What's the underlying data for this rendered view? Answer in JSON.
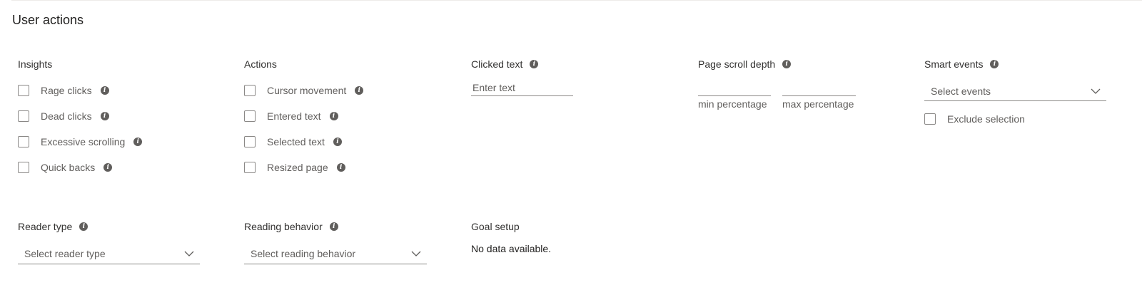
{
  "section": {
    "title": "User actions"
  },
  "insights": {
    "title": "Insights",
    "items": [
      {
        "label": "Rage clicks",
        "checked": false
      },
      {
        "label": "Dead clicks",
        "checked": false
      },
      {
        "label": "Excessive scrolling",
        "checked": false
      },
      {
        "label": "Quick backs",
        "checked": false
      }
    ]
  },
  "actions": {
    "title": "Actions",
    "items": [
      {
        "label": "Cursor movement",
        "checked": false
      },
      {
        "label": "Entered text",
        "checked": false
      },
      {
        "label": "Selected text",
        "checked": false
      },
      {
        "label": "Resized page",
        "checked": false
      }
    ]
  },
  "clicked_text": {
    "title": "Clicked text",
    "value": "",
    "placeholder": "Enter text"
  },
  "scroll_depth": {
    "title": "Page scroll depth",
    "min": {
      "value": "",
      "label": "min percentage"
    },
    "max": {
      "value": "",
      "label": "max percentage"
    }
  },
  "smart_events": {
    "title": "Smart events",
    "placeholder": "Select events",
    "exclude": {
      "label": "Exclude selection",
      "checked": false
    }
  },
  "reader_type": {
    "title": "Reader type",
    "placeholder": "Select reader type"
  },
  "reading_behavior": {
    "title": "Reading behavior",
    "placeholder": "Select reading behavior"
  },
  "goal_setup": {
    "title": "Goal setup",
    "message": "No data available."
  },
  "icons": {
    "info": "info-icon",
    "dropdown": "chevron-down-icon"
  },
  "colors": {
    "text": "#323130",
    "muted": "#605e5c",
    "border": "#8a8886",
    "icon": "#605e5c"
  }
}
